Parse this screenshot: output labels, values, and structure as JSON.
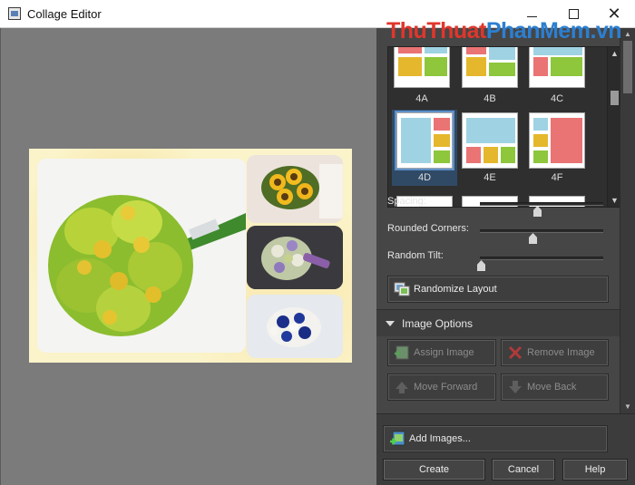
{
  "window": {
    "title": "Collage Editor",
    "minimize": "",
    "maximize": "",
    "close": "✕"
  },
  "watermark": {
    "part1": "ThuThuat",
    "part2": "PhanMem",
    "part3": ".vn"
  },
  "layouts": {
    "selected": "4D",
    "items": [
      {
        "label": "4A"
      },
      {
        "label": "4B"
      },
      {
        "label": "4C"
      },
      {
        "label": "4D"
      },
      {
        "label": "4E"
      },
      {
        "label": "4F"
      }
    ]
  },
  "sliders": [
    {
      "label": "Spacing:",
      "value": 0.47
    },
    {
      "label": "Rounded Corners:",
      "value": 0.43
    },
    {
      "label": "Random Tilt:",
      "value": 0.0
    }
  ],
  "randomize_label": "Randomize Layout",
  "image_options": {
    "header": "Image Options",
    "assign": "Assign Image",
    "remove": "Remove Image",
    "forward": "Move Forward",
    "back": "Move Back"
  },
  "footer": {
    "add_images": "Add Images...",
    "create": "Create",
    "cancel": "Cancel",
    "help": "Help"
  },
  "colors": {
    "panel_bg": "#464646",
    "canvas_bg": "#7b7b7b",
    "layout_blue": "#9fd3e3",
    "layout_red": "#ea7374",
    "layout_yellow": "#e5b72c",
    "layout_green": "#8ec63c",
    "selection": "#5c90c8"
  }
}
